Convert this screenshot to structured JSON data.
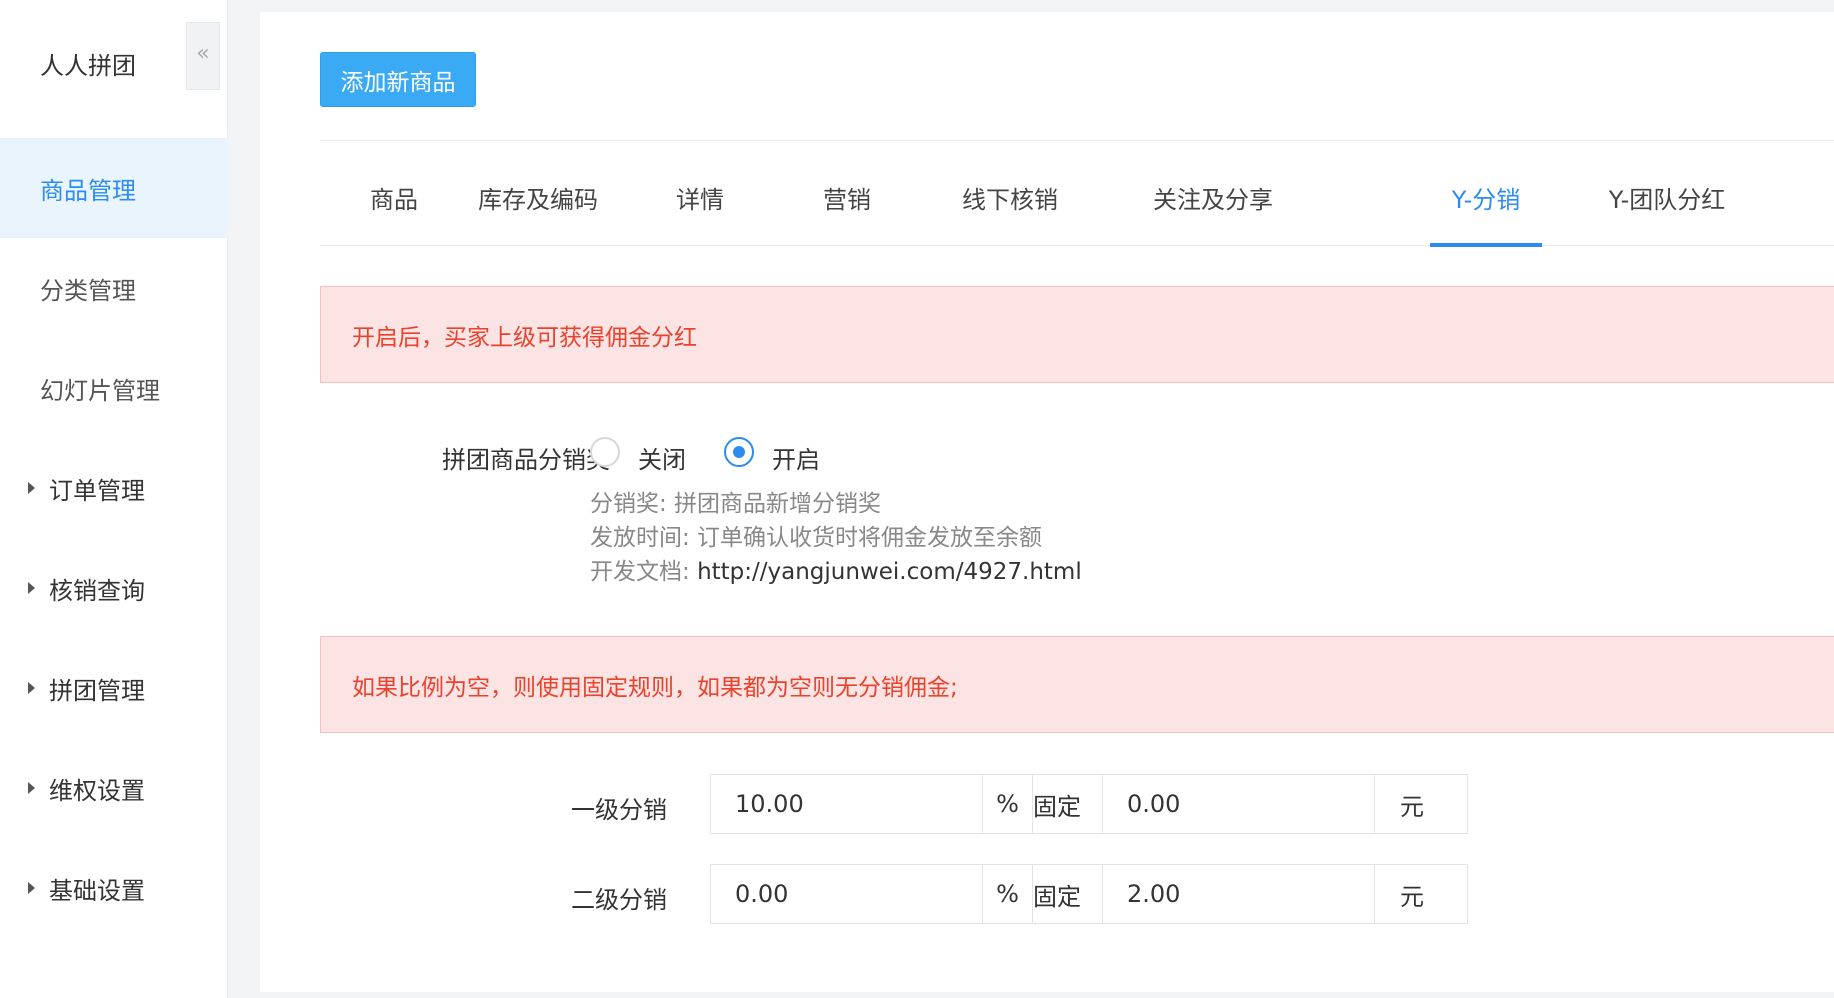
{
  "app": {
    "title": "人人拼团",
    "collapse_glyph": "«"
  },
  "sidebar": {
    "items": [
      {
        "label": "商品管理",
        "active": true
      },
      {
        "label": "分类管理"
      },
      {
        "label": "幻灯片管理"
      },
      {
        "label": "订单管理",
        "expandable": true
      },
      {
        "label": "核销查询",
        "expandable": true
      },
      {
        "label": "拼团管理",
        "expandable": true
      },
      {
        "label": "维权设置",
        "expandable": true
      },
      {
        "label": "基础设置",
        "expandable": true
      }
    ]
  },
  "toolbar": {
    "add_label": "添加新商品"
  },
  "tabs": [
    {
      "label": "商品"
    },
    {
      "label": "库存及编码"
    },
    {
      "label": "详情"
    },
    {
      "label": "营销"
    },
    {
      "label": "线下核销"
    },
    {
      "label": "关注及分享"
    },
    {
      "label": "Y-分销",
      "active": true
    },
    {
      "label": "Y-团队分红"
    }
  ],
  "alerts": {
    "top": "开启后，买家上级可获得佣金分红",
    "rule": "如果比例为空，则使用固定规则，如果都为空则无分销佣金;"
  },
  "commission": {
    "label": "拼团商品分销奖",
    "options": {
      "off": "关闭",
      "on": "开启"
    },
    "selected": "on",
    "help": {
      "line1": "分销奖: 拼团商品新增分销奖",
      "line2": "发放时间: 订单确认收货时将佣金发放至余额",
      "line3_prefix": "开发文档: ",
      "line3_url": "http://yangjunwei.com/4927.html"
    }
  },
  "levels": [
    {
      "label": "一级分销",
      "percent": "10.00",
      "percent_unit": "%",
      "fixed_label": "固定",
      "fixed": "0.00",
      "fixed_unit": "元"
    },
    {
      "label": "二级分销",
      "percent": "0.00",
      "percent_unit": "%",
      "fixed_label": "固定",
      "fixed": "2.00",
      "fixed_unit": "元"
    }
  ],
  "colors": {
    "accent": "#2d8cf0",
    "button": "#3aaaf4",
    "alert_bg": "#fce4e4",
    "alert_text": "#e9432d"
  }
}
